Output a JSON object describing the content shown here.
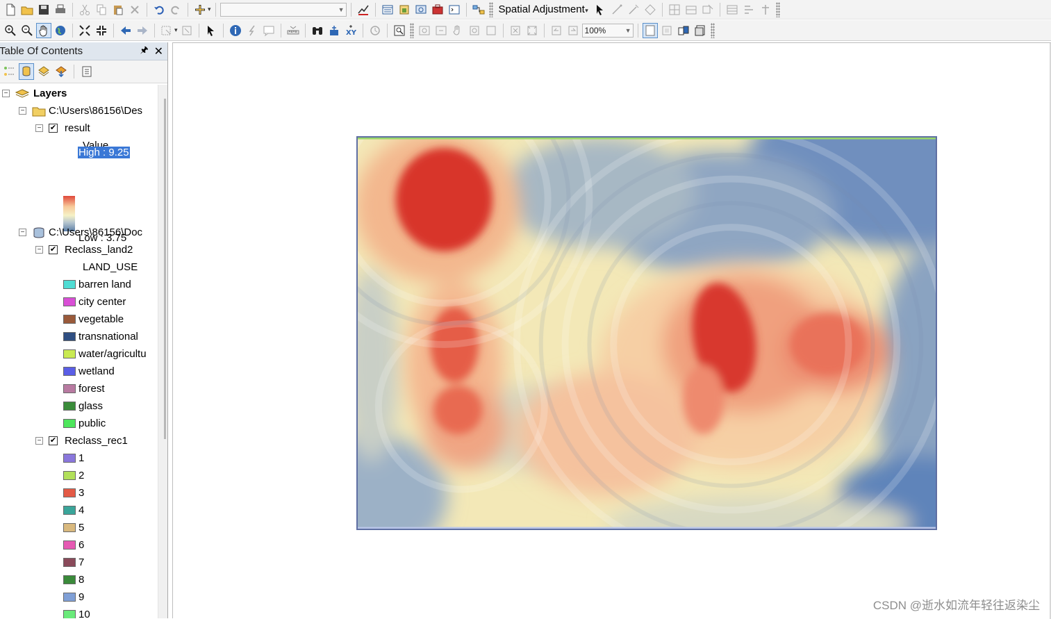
{
  "toolbar": {
    "spatial_adjustment_label": "Spatial Adjustment",
    "scale_value": "",
    "zoom_value": "100%"
  },
  "toc": {
    "title": "Table Of Contents",
    "root_label": "Layers",
    "groups": [
      {
        "path": "C:\\Users\\86156\\Des",
        "layers": [
          {
            "name": "result",
            "field": "Value",
            "high_label": "High : 9.25",
            "low_label": "Low : 3.75"
          }
        ]
      },
      {
        "path": "C:\\Users\\86156\\Doc",
        "layers": [
          {
            "name": "Reclass_land2",
            "field": "LAND_USE",
            "classes": [
              {
                "label": "barren land",
                "color": "#4fdcd3"
              },
              {
                "label": "city center",
                "color": "#d94fd6"
              },
              {
                "label": "vegetable",
                "color": "#9a5a3a"
              },
              {
                "label": "transnational",
                "color": "#2f4f82"
              },
              {
                "label": "water/agricultu",
                "color": "#c9ea52"
              },
              {
                "label": "wetland",
                "color": "#5a5ee6"
              },
              {
                "label": "forest",
                "color": "#b87aa1"
              },
              {
                "label": "glass",
                "color": "#3a8c3a"
              },
              {
                "label": "public",
                "color": "#4ee65c"
              }
            ]
          },
          {
            "name": "Reclass_rec1",
            "classes": [
              {
                "label": "1",
                "color": "#8a77dc"
              },
              {
                "label": "2",
                "color": "#b2e05a"
              },
              {
                "label": "3",
                "color": "#e45a46"
              },
              {
                "label": "4",
                "color": "#3aa59a"
              },
              {
                "label": "5",
                "color": "#d9b97e"
              },
              {
                "label": "6",
                "color": "#e65ab3"
              },
              {
                "label": "7",
                "color": "#8a4a5a"
              },
              {
                "label": "8",
                "color": "#3a8a3a"
              },
              {
                "label": "9",
                "color": "#7f9fd6"
              },
              {
                "label": "10",
                "color": "#6aea7a"
              }
            ]
          }
        ]
      }
    ]
  },
  "map": {
    "ramp_colors": [
      "#d8332a",
      "#f08c6a",
      "#f6c99c",
      "#f5eec0",
      "#b9c8cc",
      "#5b80b4"
    ]
  },
  "watermark": "CSDN @逝水如流年轻往返染尘"
}
